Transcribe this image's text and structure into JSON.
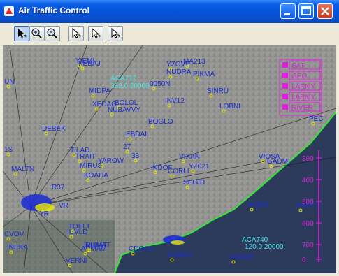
{
  "window": {
    "title": "Air Traffic Control"
  },
  "toolbar": {
    "buttons": [
      {
        "name": "select-pointer-button",
        "icon": "arrow-question-icon"
      },
      {
        "name": "zoom-in-button",
        "icon": "zoom-in-icon"
      },
      {
        "name": "zoom-out-button",
        "icon": "zoom-out-icon"
      },
      {
        "name": "mode-1-button",
        "icon": "arrow-question-icon"
      },
      {
        "name": "mode-2-button",
        "icon": "arrow-question-icon"
      },
      {
        "name": "mode-3-button",
        "icon": "arrow-question-icon"
      }
    ]
  },
  "map": {
    "waypoints": [
      "YIEMI",
      "KEBAJ",
      "YZOVE",
      "NUDRA",
      "MA213",
      "PIKMA",
      "MIDPA",
      "0050N",
      "SINRU",
      "XEDAG",
      "BOLOL",
      "NUBAVVY",
      "INV12",
      "LOBNI",
      "BOGLO",
      "DEBEK",
      "EBDAL",
      "27",
      "33",
      "TILAD",
      "TRAIT",
      "MIRUS",
      "YAROW",
      "KOAHA",
      "VIXAN",
      "IKDOF",
      "CORLI",
      "YZ021",
      "SEGID",
      "MALTN",
      "GADMI",
      "VIOSA",
      "SUBAL",
      "REKTO",
      "NLIMAT",
      "TOELT",
      "APMAM",
      "CDOCA",
      "VERNI",
      "DUBOV",
      "VOKUE",
      "PEC",
      "INEKA",
      "CVOV",
      "UN",
      "1S",
      "IRIMAT",
      "IUVLD"
    ],
    "flights": [
      {
        "callsign": "ACA712",
        "data": "352.0 20000"
      },
      {
        "callsign": "ACA740",
        "data": "120.0 20000"
      }
    ],
    "labels_misc": [
      "R37",
      "VR",
      "YR"
    ],
    "legend": [
      "SAT",
      "GEO",
      "LARMY",
      "LARMY",
      "RIVER"
    ],
    "altitude_scale": [
      {
        "value": "300"
      },
      {
        "value": "400"
      },
      {
        "value": "500"
      },
      {
        "value": "600"
      },
      {
        "value": "700"
      },
      {
        "value": "0"
      }
    ],
    "colors": {
      "label": "#1a2bd6",
      "flight": "#40e8e8",
      "legend": "#e020e0",
      "coast": "#33e633",
      "waypoint": "#e8e800"
    }
  }
}
